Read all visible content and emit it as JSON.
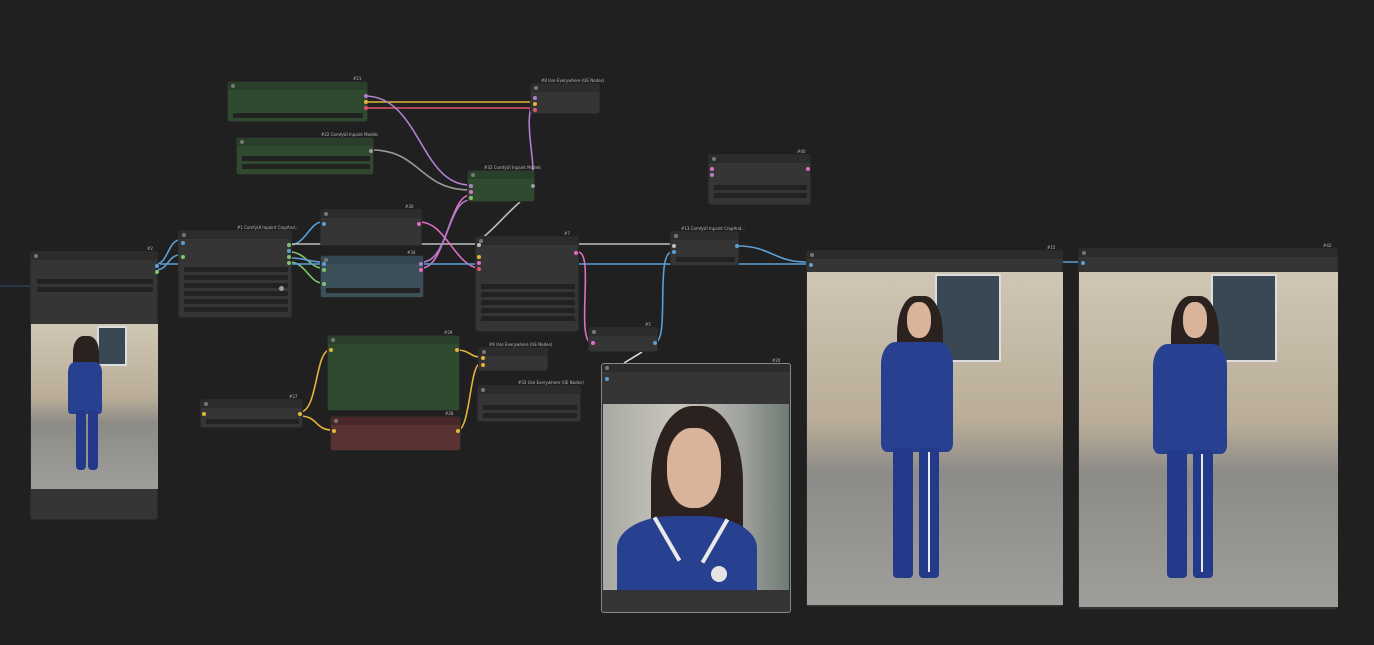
{
  "app": {
    "name": "ComfyUI workflow canvas"
  },
  "nodes": {
    "n2": {
      "title": "#2"
    },
    "n21": {
      "title": "#21"
    },
    "n22": {
      "title": "#22 ComfyUI Inpaint Models"
    },
    "n8": {
      "title": "#8 Use Everywhere (UE Nodes)"
    },
    "n1": {
      "title": "#1 ComfyUI Inpaint CropAnd..."
    },
    "n30": {
      "title": "#30"
    },
    "n34": {
      "title": "#34"
    },
    "n32": {
      "title": "#32 ComfyUI Inpaint Models"
    },
    "n7": {
      "title": "#7"
    },
    "n13": {
      "title": "#13 ComfyUI Inpaint CropAnd..."
    },
    "n40": {
      "title": "#40"
    },
    "n29": {
      "title": "#29"
    },
    "n28": {
      "title": "#28"
    },
    "n27": {
      "title": "#27"
    },
    "n6": {
      "title": "#6 Use Everywhere (UE Nodes)"
    },
    "n33": {
      "title": "#33 Use Everywhere (UE Nodes)"
    },
    "n5": {
      "title": "#5"
    },
    "n20": {
      "title": "#20"
    },
    "n15": {
      "title": "#15"
    },
    "n42": {
      "title": "#42"
    }
  },
  "colors": {
    "canvas": "#202020",
    "node": "#353535",
    "green_node": "#304a2f",
    "red_node": "#5a3232",
    "blue_node": "#3b5059",
    "wire_blue": "#5b9fd6",
    "wire_purple": "#b07fd0",
    "wire_pink": "#e06ec7",
    "wire_yellow": "#e2b536",
    "wire_red": "#e0566a",
    "wire_gray": "#bdbdbd",
    "badge": "#d4a017"
  },
  "images": {
    "input_photo": "woman in blue patterned pajama suit walking on cobblestones",
    "closeup": "long-haired man face close-up wearing blue patterned shirt",
    "result_1": "long-haired man in blue patterned pajama suit walking",
    "result_2": "woman in blue patterned pajama suit walking"
  }
}
